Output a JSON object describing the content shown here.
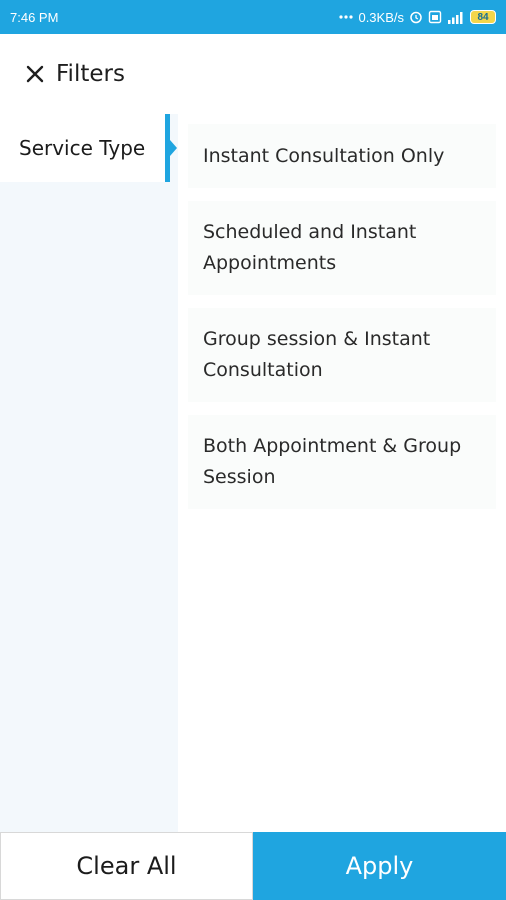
{
  "status_bar": {
    "time": "7:46 PM",
    "network_speed": "0.3KB/s",
    "battery_level": "84",
    "icons": [
      "dots-icon",
      "alarm-icon",
      "sim-icon",
      "signal-icon",
      "battery-icon"
    ]
  },
  "header": {
    "title": "Filters",
    "close_icon": "close-icon"
  },
  "sidebar": {
    "items": [
      {
        "label": "Service Type",
        "selected": true
      }
    ]
  },
  "options": [
    {
      "label": "Instant Consultation Only"
    },
    {
      "label": "Scheduled and Instant Appointments"
    },
    {
      "label": "Group session & Instant Consultation"
    },
    {
      "label": "Both Appointment & Group Session"
    }
  ],
  "footer": {
    "clear_label": "Clear All",
    "apply_label": "Apply"
  },
  "colors": {
    "accent": "#1fa5e0",
    "sidebar_bg": "#f3f8fc",
    "option_bg": "#fafcfb"
  }
}
